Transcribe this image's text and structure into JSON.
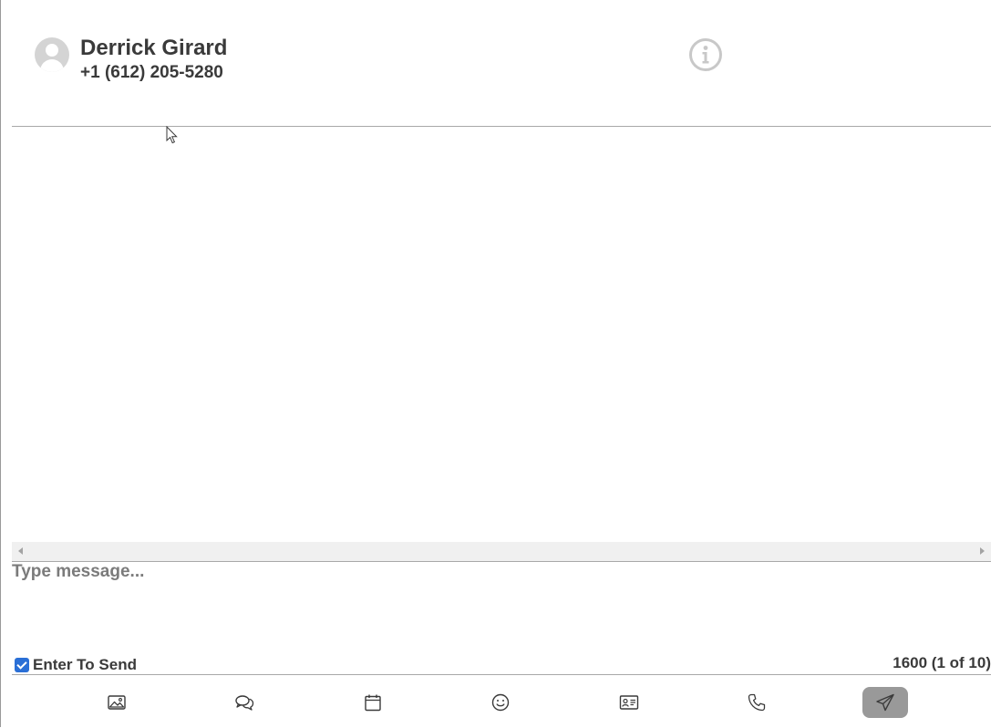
{
  "contact": {
    "name": "Derrick Girard",
    "phone": "+1 (612) 205-5280"
  },
  "header": {
    "avatar_icon": "user-avatar-icon",
    "info_icon": "info-icon"
  },
  "compose": {
    "placeholder": "Type message...",
    "value": "",
    "enter_to_send_label": "Enter To Send",
    "enter_to_send_checked": true,
    "char_count": "1600 (1 of 10)"
  },
  "toolbar": {
    "buttons": [
      {
        "name": "image-button",
        "icon": "image-icon"
      },
      {
        "name": "chat-templates-button",
        "icon": "chat-bubbles-icon"
      },
      {
        "name": "schedule-button",
        "icon": "calendar-icon"
      },
      {
        "name": "emoji-button",
        "icon": "smiley-icon"
      },
      {
        "name": "contact-card-button",
        "icon": "contact-card-icon"
      },
      {
        "name": "call-button",
        "icon": "phone-icon"
      },
      {
        "name": "send-button",
        "icon": "send-icon"
      }
    ]
  },
  "colors": {
    "text": "#3a3a3a",
    "placeholder": "#7b7b7b",
    "checkbox": "#2a6fd6",
    "send_button_bg": "#999999",
    "divider": "#a8a8a8",
    "avatar_bg": "#d4d4d4"
  }
}
